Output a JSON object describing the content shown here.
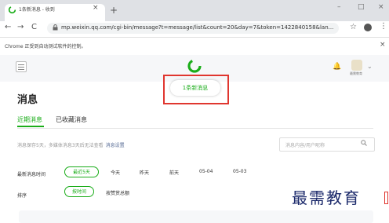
{
  "browser": {
    "tab_title": "1条新消息 - 收到",
    "tab_close": "×",
    "new_tab": "+",
    "win_min": "–",
    "win_max": "□",
    "win_close": "×",
    "back": "←",
    "forward": "→",
    "reload": "C",
    "url": "mp.weixin.qq.com/cgi-bin/message?t=message/list&count=20&day=7&token=1422840158&lan...",
    "star": "☆",
    "menu": "⋮",
    "infobar_text": "Chrome 正受到自动测试软件的控制。",
    "infobar_close": "×"
  },
  "header": {
    "bell": "🔔",
    "avatar_caption": "最需教育",
    "chevron": "⌄"
  },
  "notification": {
    "label": "1条新消息"
  },
  "page": {
    "title": "消息",
    "tabs": [
      "近期消息",
      "已收藏消息"
    ],
    "hint": "消息保存5天，多媒体消息3天后无法查看",
    "hint_link": "消息设置",
    "search_placeholder": "消息内容/用户昵称"
  },
  "filters": {
    "time_label": "最新消息时间",
    "time_options": [
      "最近5天",
      "今天",
      "昨天",
      "前天",
      "05-04",
      "05-03"
    ],
    "sort_label": "排序",
    "sort_options": [
      "按时间",
      "按赞赏总额"
    ]
  },
  "watermark": "最需教育",
  "colors": {
    "accent": "#1aad19",
    "highlight": "#e0362f",
    "link": "#576b95"
  }
}
